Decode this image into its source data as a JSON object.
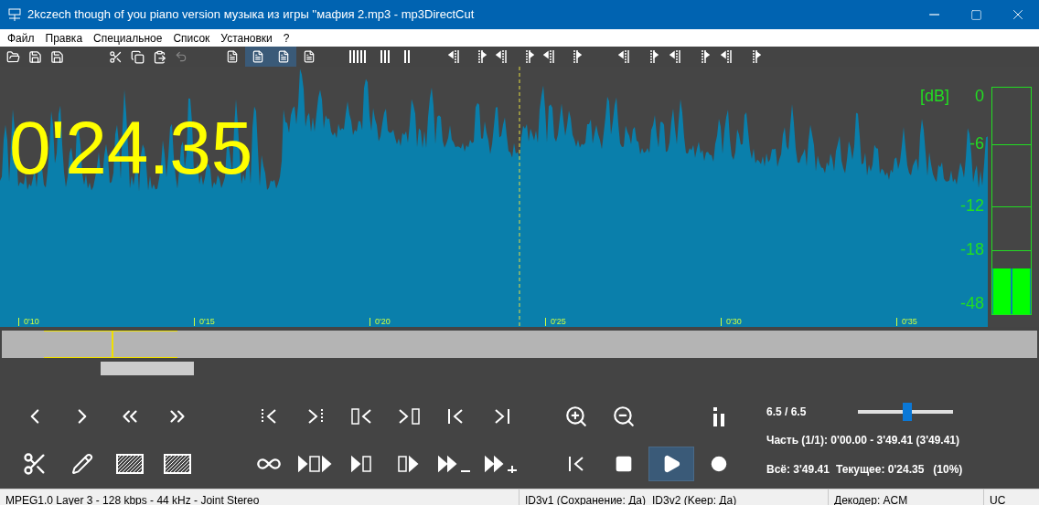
{
  "window": {
    "title": "2kczech though of you piano version музыка из игры ''мафия 2.mp3 - mp3DirectCut"
  },
  "menu": [
    "Файл",
    "Правка",
    "Специальное",
    "Список",
    "Установки",
    "?"
  ],
  "document_buttons": [
    {
      "selected": false
    },
    {
      "selected": true
    },
    {
      "selected": true
    },
    {
      "selected": false
    }
  ],
  "waveform": {
    "position": "0'24.35",
    "timeline": [
      "0'10",
      "0'15",
      "0'20",
      "0'25",
      "0'30",
      "0'35"
    ]
  },
  "meter": {
    "unit": "[dB]",
    "scale": [
      "0",
      "-6",
      "-12",
      "-18",
      "-48"
    ],
    "channels": [
      {
        "level": 0.2
      },
      {
        "level": 0.2
      }
    ]
  },
  "transport": [
    {
      "selected": false
    },
    {
      "selected": false
    },
    {
      "selected": true
    },
    {
      "selected": false
    }
  ],
  "info": {
    "volume": "6.5 / 6.5",
    "volume_slider": {
      "level": 0.52
    },
    "part": "Часть (1/1): 0'00.00 - 3'49.41 (3'49.41)",
    "total": "Всё: 3'49.41",
    "current": "Текущее: 0'24.35",
    "percent": "(10%)"
  },
  "status_bar": [
    "MPEG1.0 Layer 3 - 128 kbps - 44 kHz - Joint Stereo",
    "ID3v1 (Сохранение: Да)",
    "ID3v2 (Keep: Да)",
    "Декодер: ACM",
    "UC"
  ]
}
